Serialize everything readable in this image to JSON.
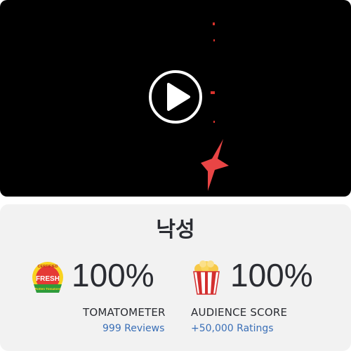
{
  "video": {
    "play_icon": "play-icon"
  },
  "movie": {
    "title": "낙성"
  },
  "tomatometer": {
    "badge_top": "CERTIFIED",
    "badge_main": "FRESH",
    "badge_bottom": "Rotten Tomatoes",
    "value": "100%",
    "label": "TOMATOMETER",
    "link": "999 Reviews"
  },
  "audience": {
    "icon": "popcorn-icon",
    "value": "100%",
    "label": "AUDIENCE SCORE",
    "link": "+50,000 Ratings"
  },
  "colors": {
    "link": "#3a6fb7",
    "text": "#2a2c32",
    "card_bg": "#f2f2f2",
    "accent_red": "#e53935"
  }
}
